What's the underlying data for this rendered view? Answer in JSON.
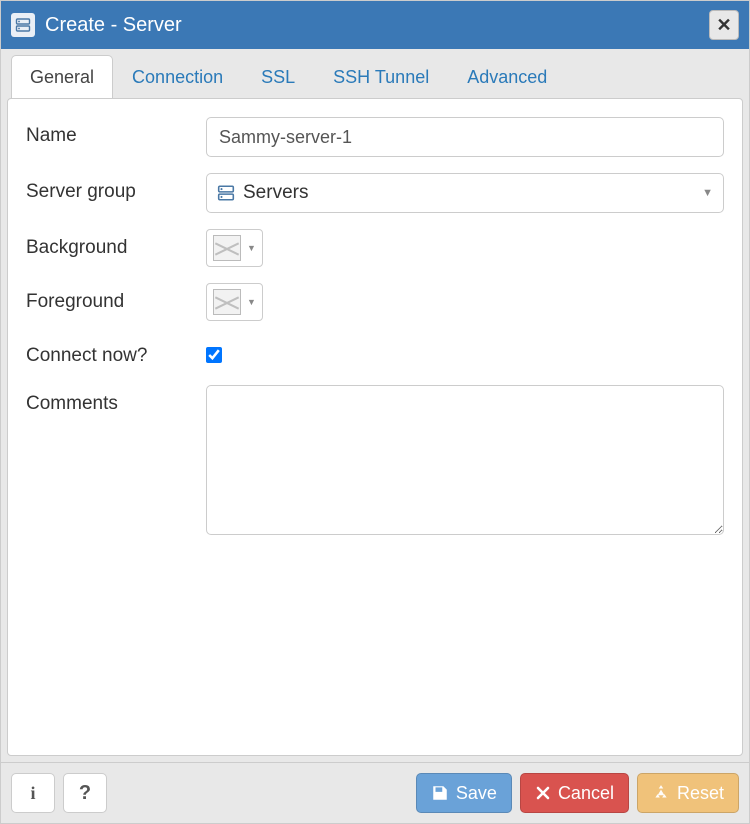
{
  "dialog": {
    "title": "Create - Server"
  },
  "tabs": {
    "items": [
      {
        "label": "General",
        "active": true
      },
      {
        "label": "Connection",
        "active": false
      },
      {
        "label": "SSL",
        "active": false
      },
      {
        "label": "SSH Tunnel",
        "active": false
      },
      {
        "label": "Advanced",
        "active": false
      }
    ]
  },
  "form": {
    "name": {
      "label": "Name",
      "value": "Sammy-server-1"
    },
    "server_group": {
      "label": "Server group",
      "value": "Servers"
    },
    "background": {
      "label": "Background",
      "value": "none"
    },
    "foreground": {
      "label": "Foreground",
      "value": "none"
    },
    "connect_now": {
      "label": "Connect now?",
      "checked": true
    },
    "comments": {
      "label": "Comments",
      "value": ""
    }
  },
  "footer": {
    "save": "Save",
    "cancel": "Cancel",
    "reset": "Reset"
  }
}
